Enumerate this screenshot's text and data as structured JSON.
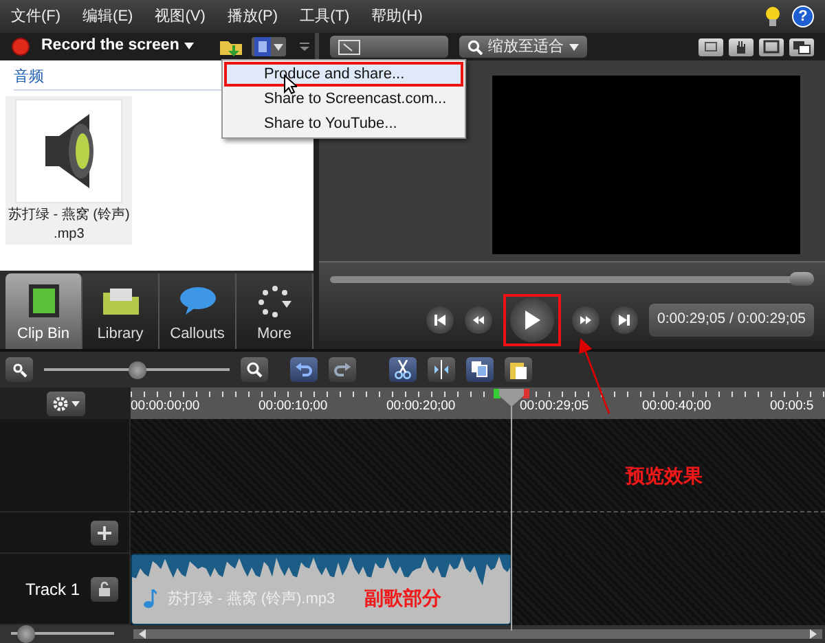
{
  "menu_bar": {
    "items": [
      "文件(F)",
      "编辑(E)",
      "视图(V)",
      "播放(P)",
      "工具(T)",
      "帮助(H)"
    ],
    "help_glyph": "?"
  },
  "toolbar": {
    "record_label": "Record the screen",
    "produce_open": true
  },
  "produce_menu": {
    "items": [
      {
        "label": "Produce and share...",
        "selected": true
      },
      {
        "label": "Share to Screencast.com...",
        "selected": false
      },
      {
        "label": "Share to YouTube...",
        "selected": false
      }
    ]
  },
  "preview_toolbar": {
    "zoom_label": "缩放至适合"
  },
  "clip_bin": {
    "section": "音频",
    "clips": [
      {
        "name": "苏打绿 - 燕窝 (铃声)",
        "ext": ".mp3"
      }
    ]
  },
  "tabs": [
    {
      "label": "Clip Bin",
      "selected": true
    },
    {
      "label": "Library",
      "selected": false
    },
    {
      "label": "Callouts",
      "selected": false
    },
    {
      "label": "More",
      "selected": false
    }
  ],
  "player": {
    "seek": {
      "level": 1
    },
    "time": "0:00:29;05 / 0:00:29;05"
  },
  "timeline": {
    "zoom": {
      "level": 0.5
    },
    "track_height": {
      "level": 0.15
    },
    "ruler_labels": [
      {
        "text": "00:00:00;00",
        "kind": "tick"
      },
      {
        "text": "00:00:10;00",
        "kind": "tick"
      },
      {
        "text": "00:00:20;00",
        "kind": "tick"
      },
      {
        "text": "00:00:29;05",
        "kind": "playhead"
      },
      {
        "text": "00:00:40;00",
        "kind": "tick"
      },
      {
        "text": "00:00:5",
        "kind": "tick"
      }
    ],
    "tracks": [
      {
        "name": "Track 1",
        "clip": "苏打绿 - 燕窝 (铃声).mp3"
      }
    ]
  },
  "annotations": [
    {
      "text": "预览效果",
      "kind": "preview"
    },
    {
      "text": "副歌部分",
      "kind": "clip"
    }
  ]
}
